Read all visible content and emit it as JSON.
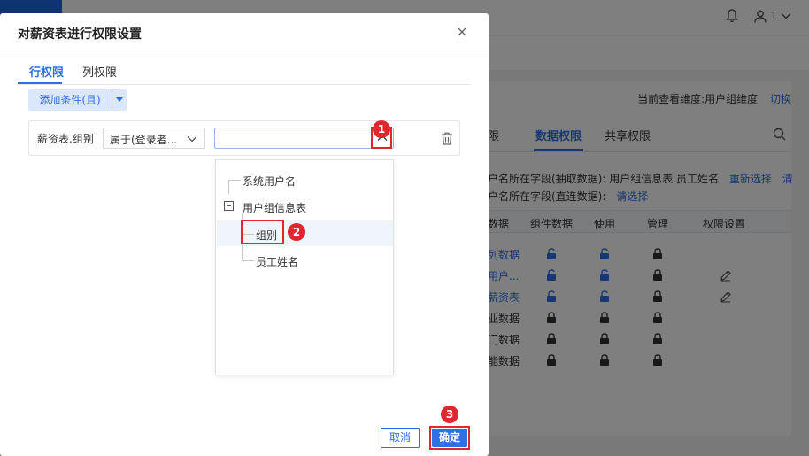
{
  "background": {
    "current_view_label": "当前查看维度:用户组维度",
    "switch_link": "切换",
    "tabs": [
      "限",
      "数据权限",
      "共享权限"
    ],
    "field_extract_label": "户名所在字段(抽取数据): 用户组信息表.员工姓名",
    "reselect_link": "重新选择",
    "cut_link": "清",
    "field_direct_label": "户名所在字段(直连数据):",
    "select_link": "请选择",
    "table_headers": [
      "数据",
      "组件数据",
      "使用",
      "管理",
      "权限设置"
    ],
    "table_rows": [
      {
        "name": "列数据",
        "blue": true,
        "locks": [
          "unlocked",
          "unlocked",
          "locked"
        ],
        "edit": false
      },
      {
        "name": "用户...",
        "blue": true,
        "locks": [
          "unlocked",
          "unlocked",
          "locked"
        ],
        "edit": true
      },
      {
        "name": "薪资表",
        "blue": true,
        "locks": [
          "unlocked",
          "unlocked",
          "locked"
        ],
        "edit": true
      },
      {
        "name": "业数据",
        "blue": false,
        "locks": [
          "locked",
          "locked",
          "locked"
        ],
        "edit": false
      },
      {
        "name": "门数据",
        "blue": false,
        "locks": [
          "locked",
          "locked",
          "locked"
        ],
        "edit": false
      },
      {
        "name": "能数据",
        "blue": false,
        "locks": [
          "locked",
          "locked",
          "locked"
        ],
        "edit": false
      }
    ],
    "user_badge": "1",
    "icons": [
      "bell-icon",
      "user-icon",
      "search-icon",
      "lock-icon",
      "edit-icon"
    ]
  },
  "dialog": {
    "title": "对薪资表进行权限设置",
    "tabs": {
      "row": "行权限",
      "column": "列权限"
    },
    "add_condition_label": "添加条件(且)",
    "condition": {
      "field": "薪资表.组别",
      "operator": "属于(登录者...",
      "value": ""
    },
    "tree": {
      "items": [
        "系统用户名",
        "用户组信息表",
        "组别",
        "员工姓名"
      ]
    },
    "cancel_label": "取消",
    "ok_label": "确定"
  },
  "markers": [
    "1",
    "2",
    "3"
  ],
  "colors": {
    "accent": "#2f6fe4",
    "marker": "#e0262e"
  }
}
